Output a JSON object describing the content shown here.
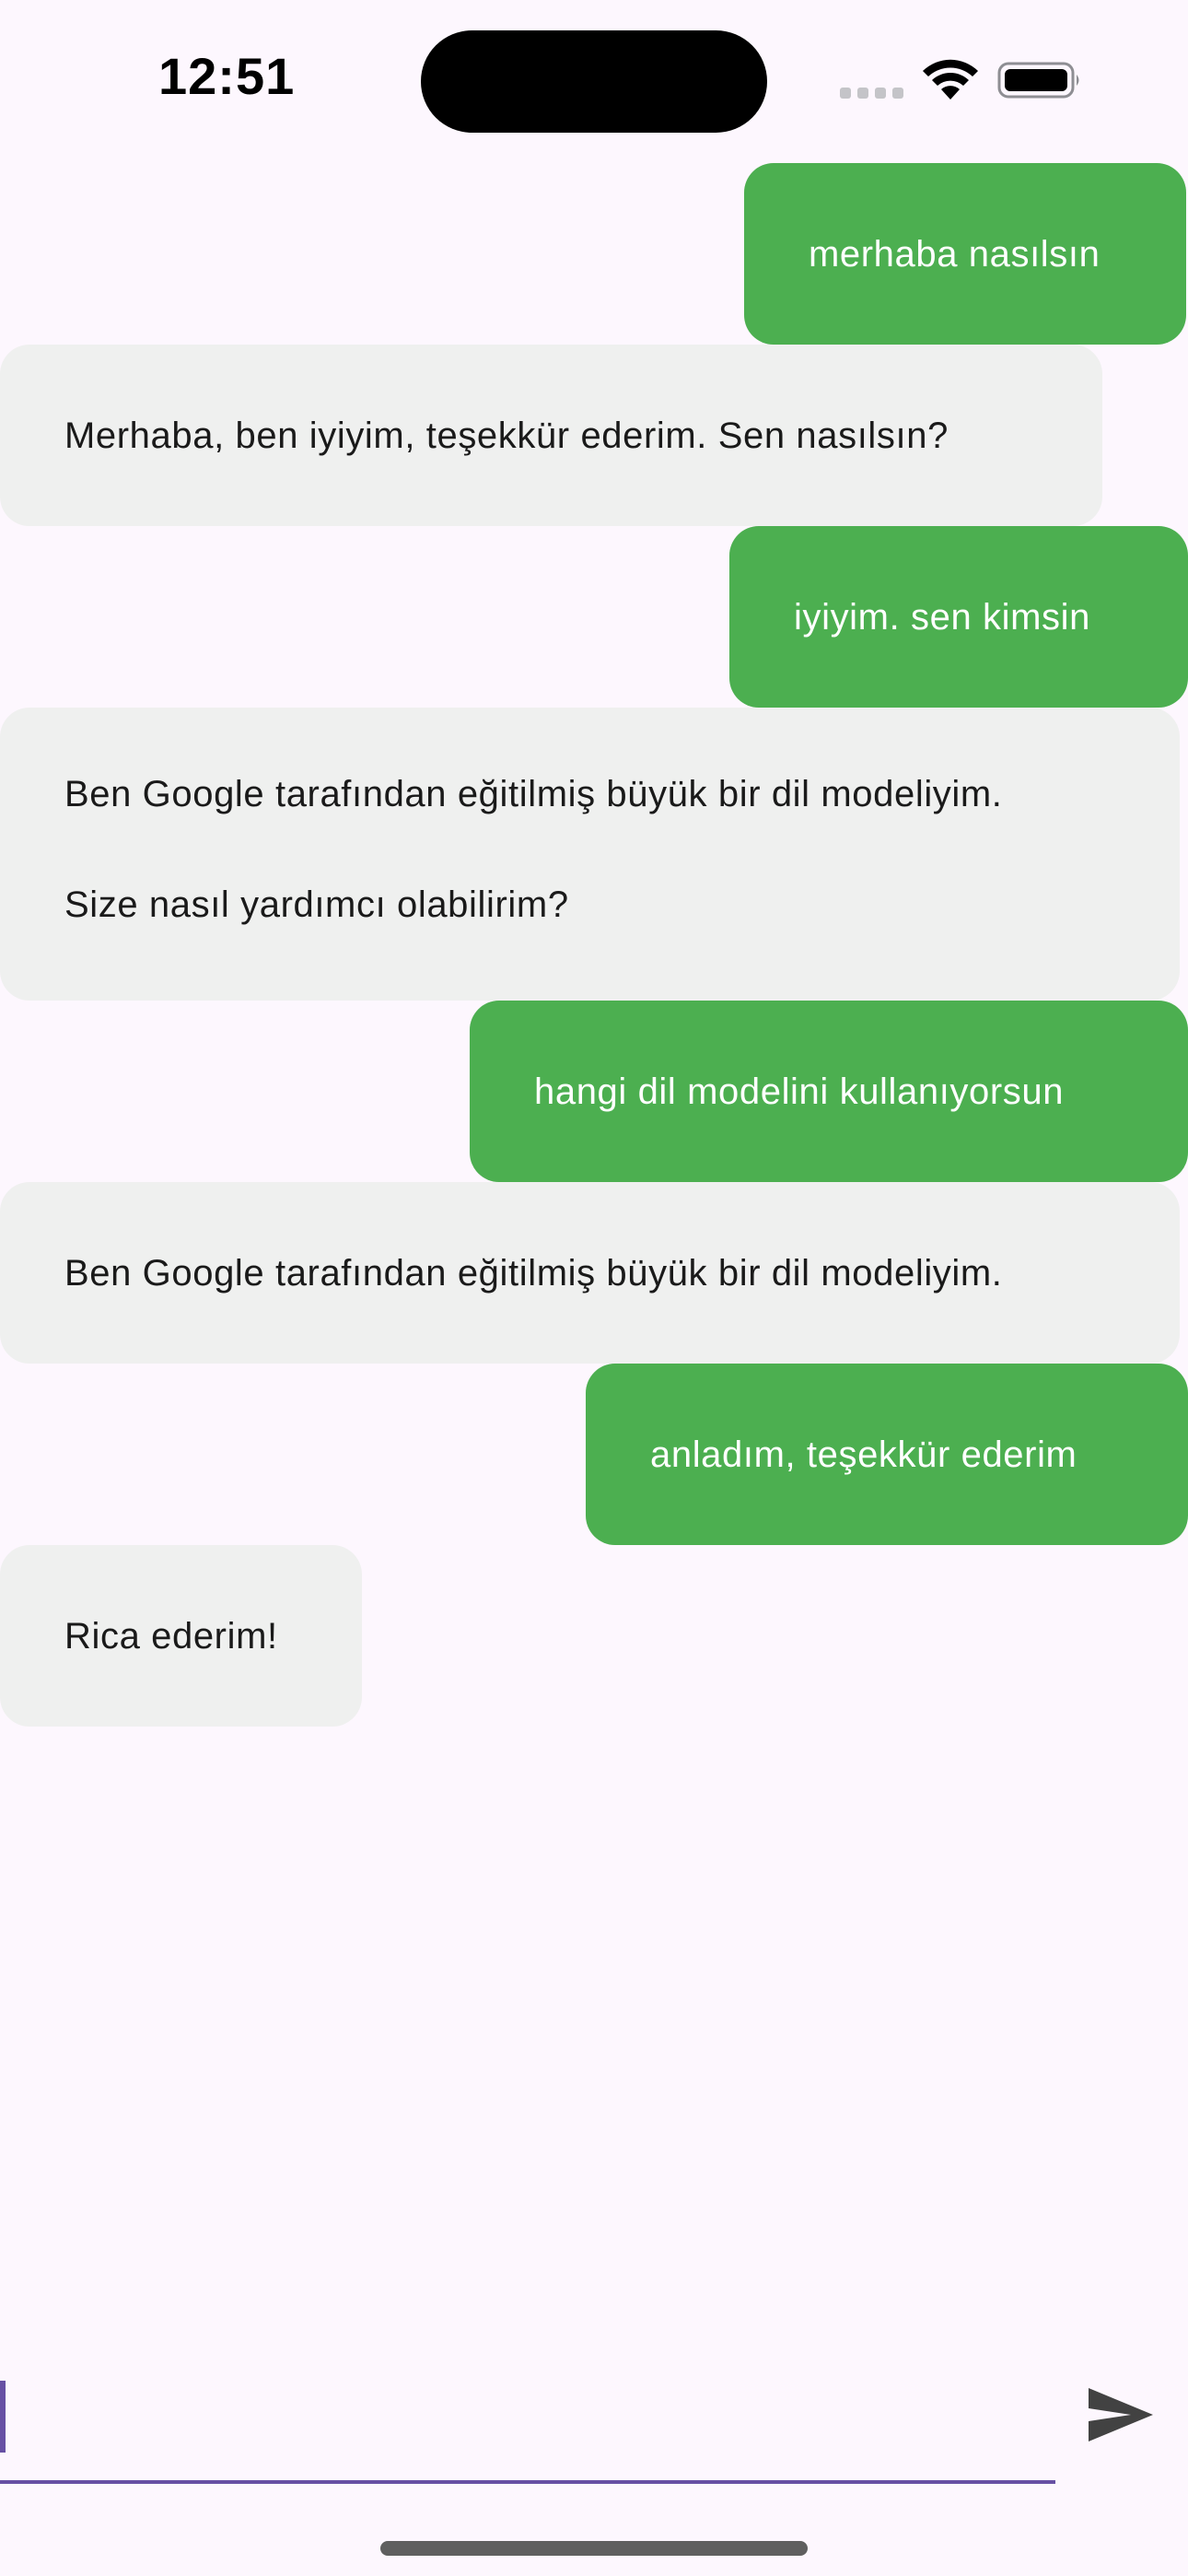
{
  "status_bar": {
    "time": "12:51",
    "icons": [
      "cellular-signal-icon",
      "wifi-icon",
      "battery-icon"
    ]
  },
  "colors": {
    "background": "#fdf7fe",
    "user_bubble": "#4caf50",
    "bot_bubble": "#eff0ef",
    "accent": "#6750a4"
  },
  "messages": [
    {
      "role": "user",
      "lines": [
        "merhaba nasılsın"
      ]
    },
    {
      "role": "bot",
      "lines": [
        "Merhaba, ben iyiyim, teşekkür ederim. Sen nasılsın?"
      ]
    },
    {
      "role": "user",
      "lines": [
        "iyiyim. sen kimsin"
      ]
    },
    {
      "role": "bot",
      "lines": [
        "Ben Google tarafından eğitilmiş büyük bir dil modeliyim.",
        "Size nasıl yardımcı olabilirim?"
      ]
    },
    {
      "role": "user",
      "lines": [
        "hangi dil modelini kullanıyorsun"
      ]
    },
    {
      "role": "bot",
      "lines": [
        "Ben Google tarafından eğitilmiş büyük bir dil modeliyim."
      ]
    },
    {
      "role": "user",
      "lines": [
        "anladım, teşekkür ederim"
      ]
    },
    {
      "role": "bot",
      "lines": [
        "Rica ederim!"
      ]
    }
  ],
  "composer": {
    "value": "",
    "send_icon": "send-icon"
  }
}
